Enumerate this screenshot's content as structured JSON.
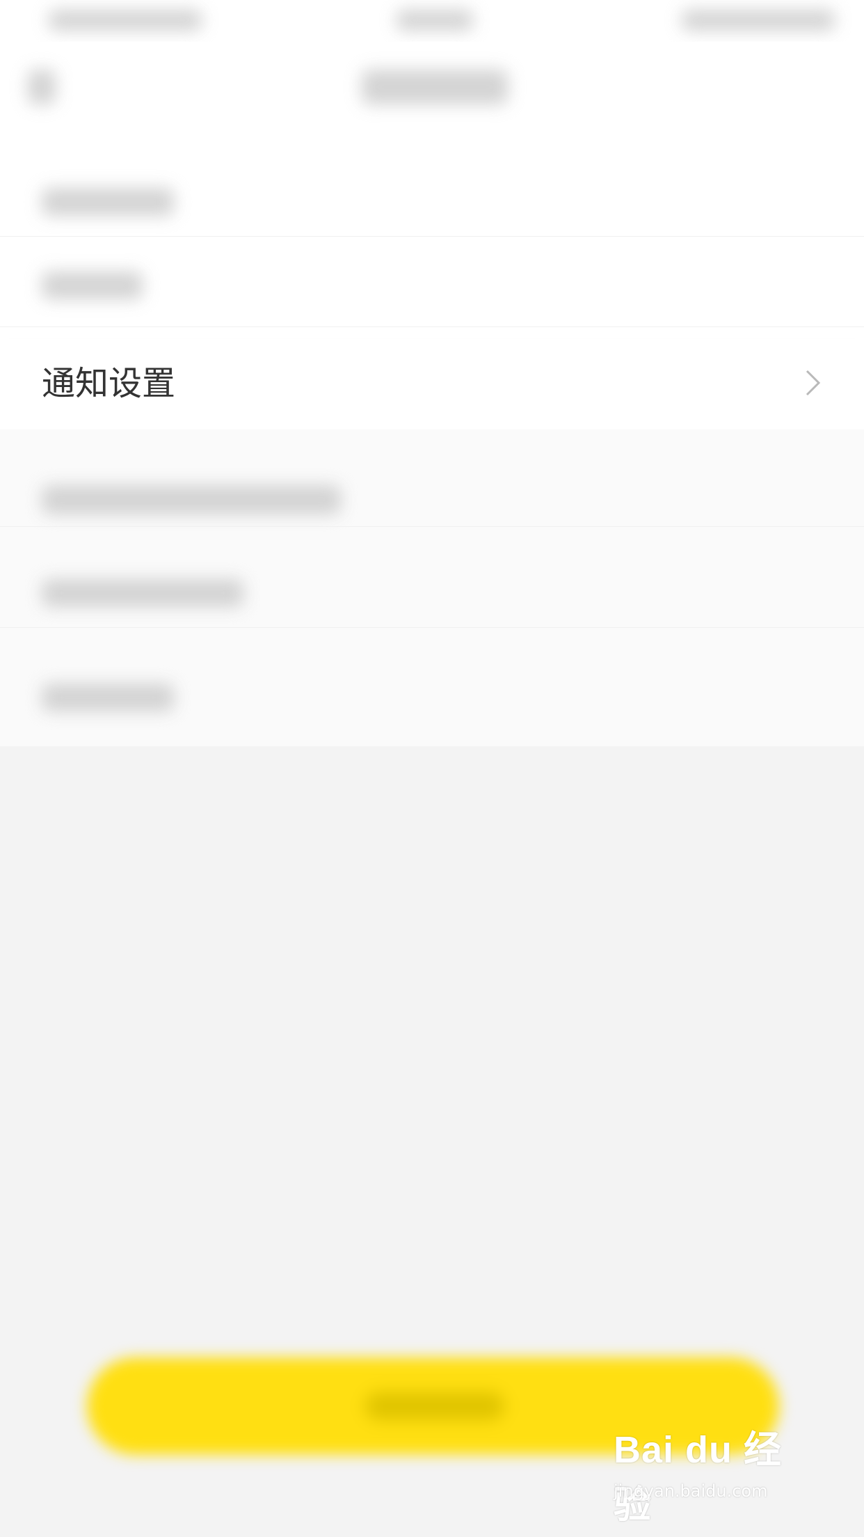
{
  "main": {
    "row": {
      "label": "通知设置",
      "icon": "chevron-right-icon"
    }
  },
  "watermark": {
    "logo": "Bai du 经验",
    "url": "jingyan.baidu.com"
  },
  "colors": {
    "accent": "#ffdf12",
    "background": "#f3f3f3",
    "text": "#333333"
  }
}
